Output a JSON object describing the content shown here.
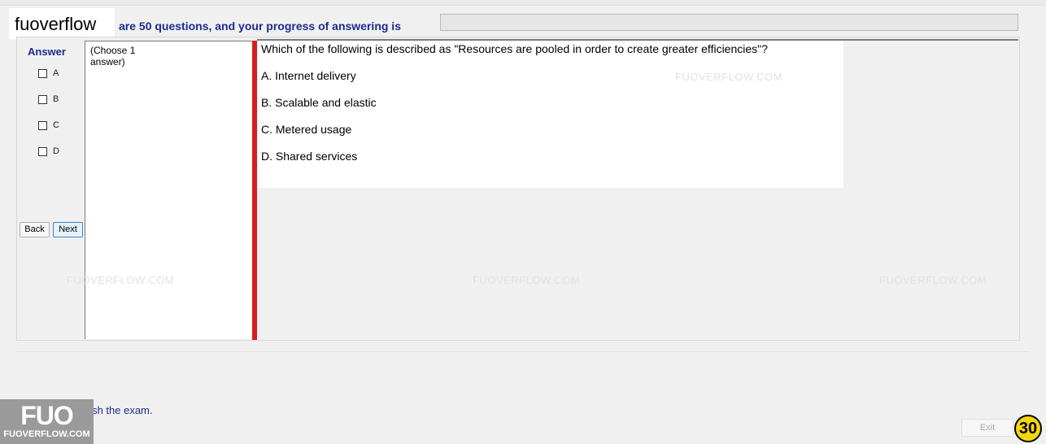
{
  "header": {
    "brand": "fuoverflow",
    "question_info": "are 50 questions, and your progress of answering is",
    "progress_fraction": 0
  },
  "answer_panel": {
    "heading": "Answer",
    "options": [
      "A",
      "B",
      "C",
      "D"
    ],
    "back_label": "Back",
    "next_label": "Next"
  },
  "choose_hint": "(Choose 1 answer)",
  "question": {
    "text": "Which of the following is described as \"Resources are pooled in order to create greater efficiencies\"?",
    "choices": [
      "A.  Internet delivery",
      "B.  Scalable and elastic",
      "C.  Metered usage",
      "D.  Shared services"
    ]
  },
  "watermarks": [
    "FUOVERFLOW.COM",
    "FUOVERFLOW.COM",
    "FUOVERFLOW.COM",
    "FUOVERFLOW.COM"
  ],
  "footer": {
    "finish_text": "to finish the exam.",
    "logo_main": "FUO",
    "logo_sub": "FUOVERFLOW.COM",
    "exit_label": "Exit",
    "timer_value": "30"
  },
  "colors": {
    "accent_blue": "#1b2c91",
    "divider_red": "#d1201f",
    "timer_yellow": "#f5d60f"
  }
}
